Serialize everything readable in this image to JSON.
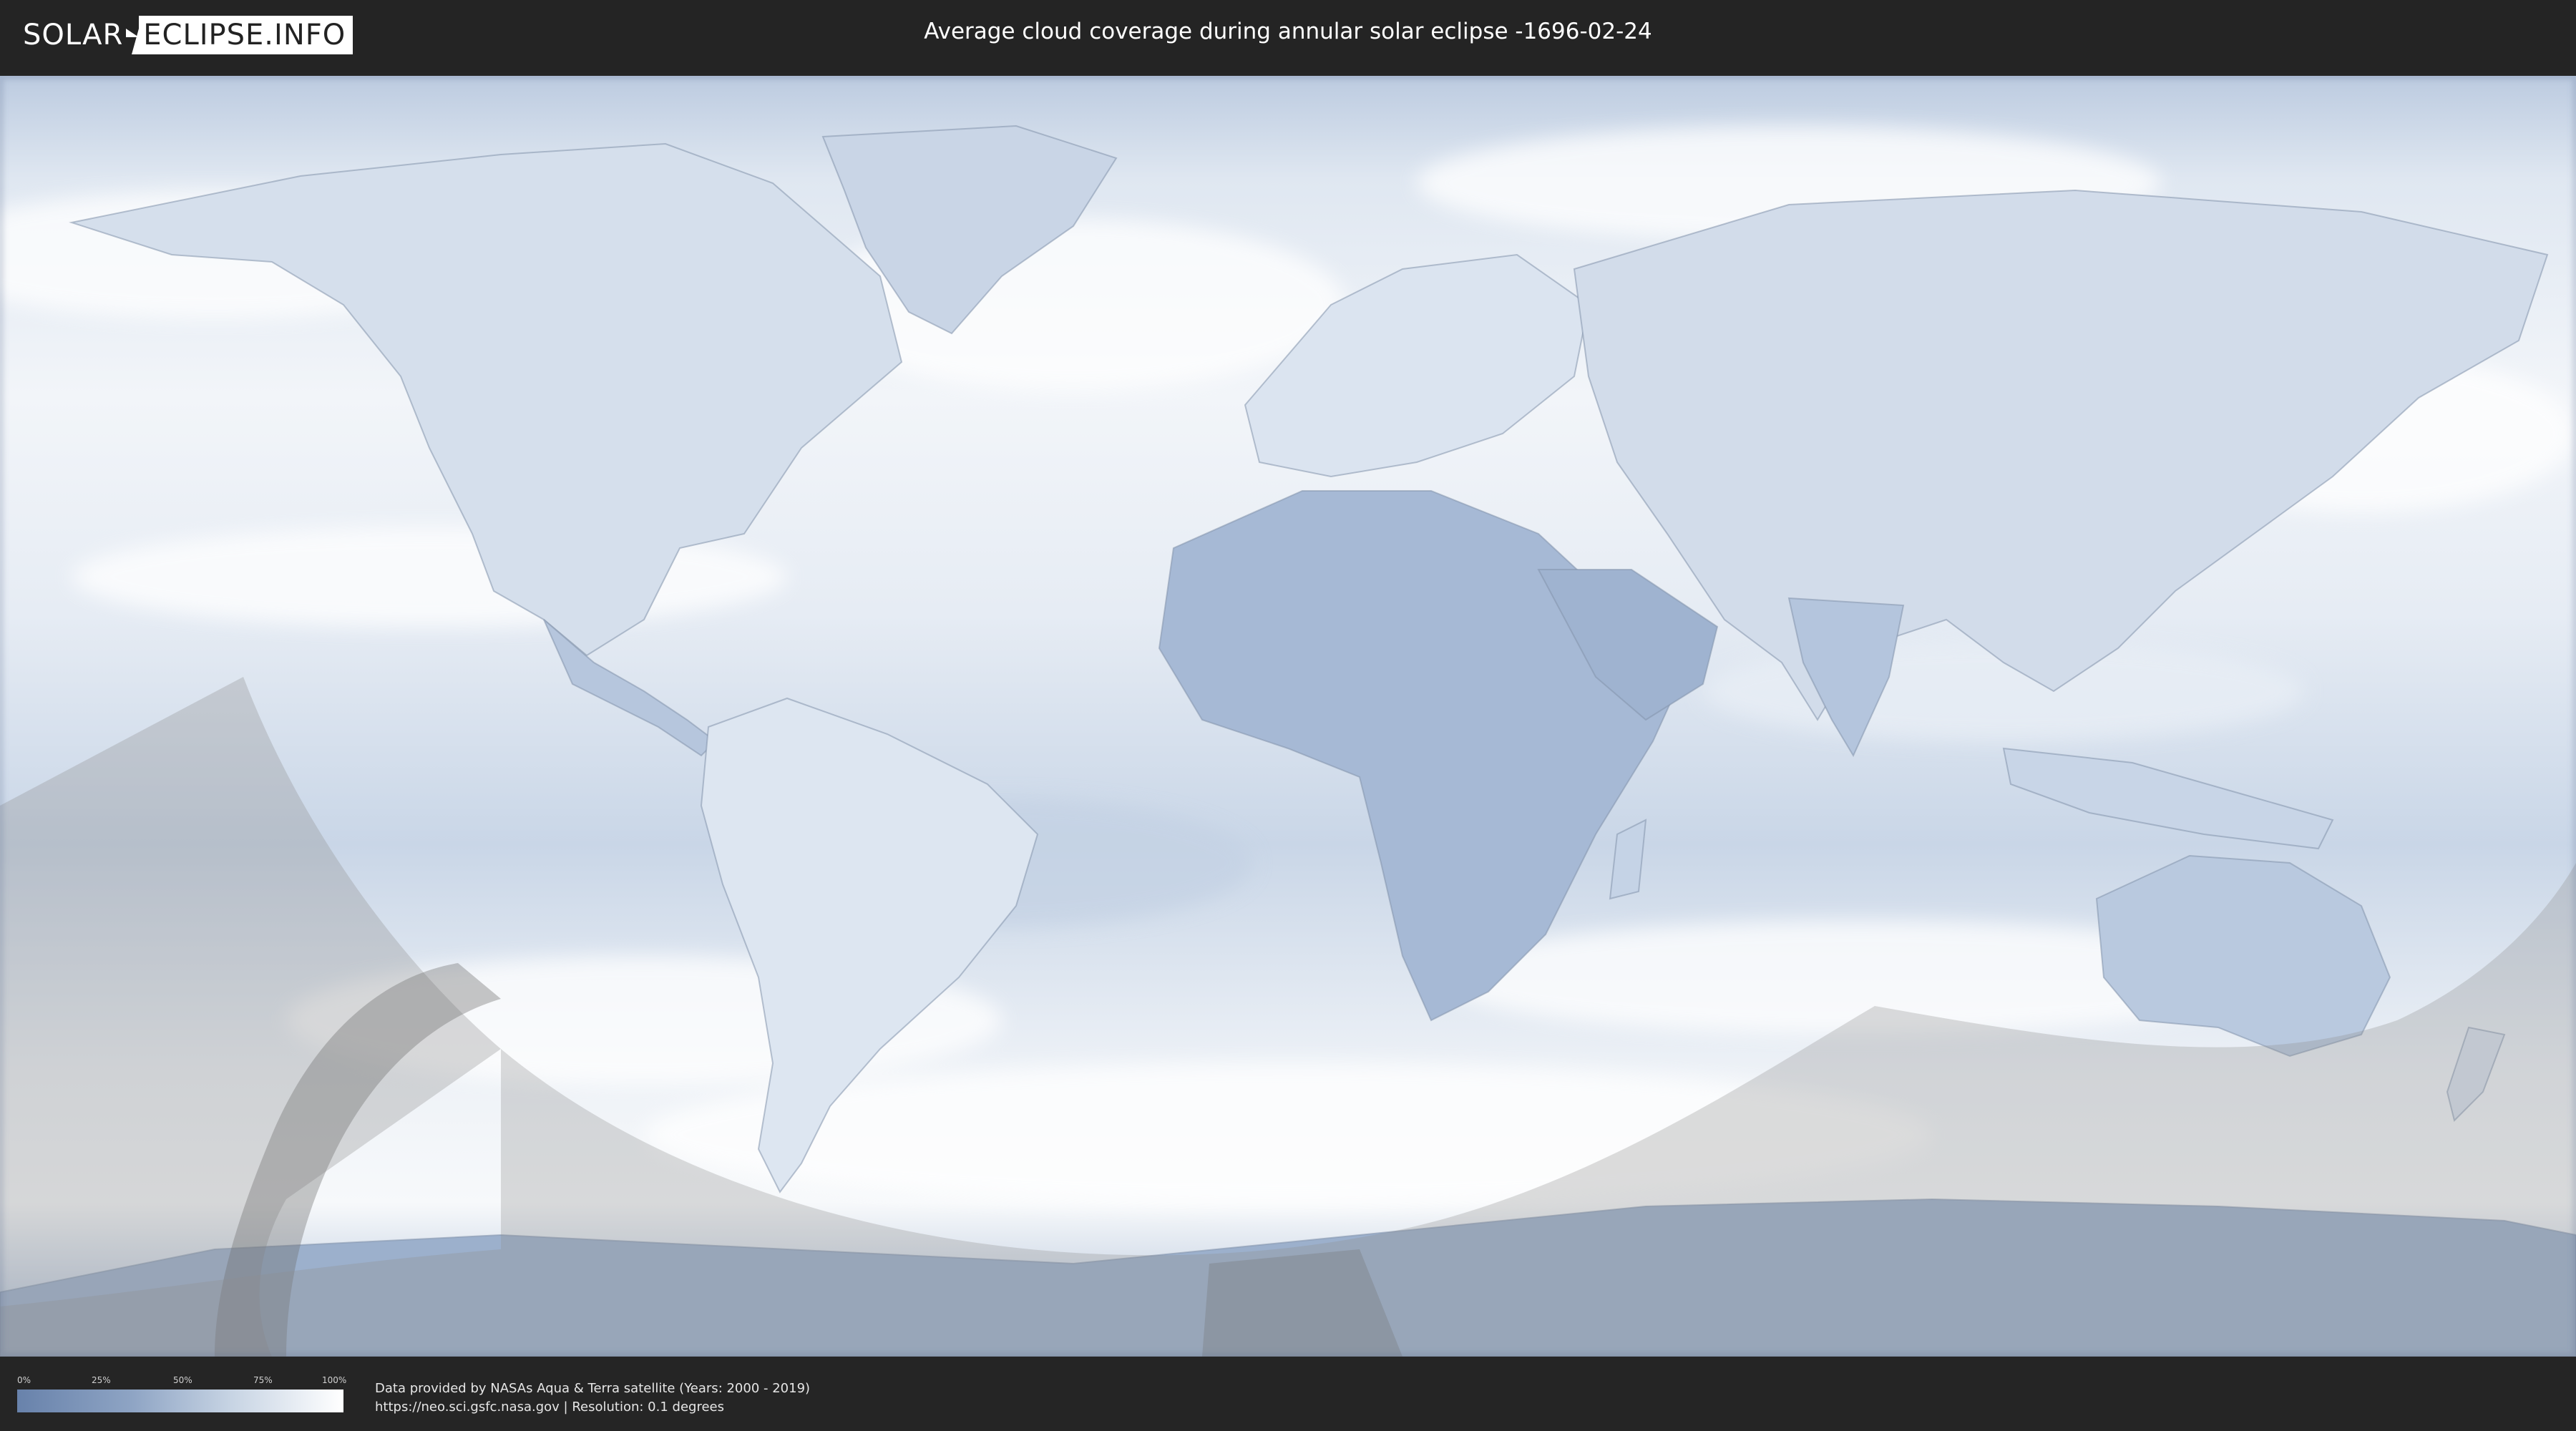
{
  "header": {
    "logo_left": "SOLAR",
    "logo_right": "ECLIPSE.INFO",
    "title": "Average cloud coverage during annular solar eclipse -1696-02-24"
  },
  "map": {
    "layer": "cloud-coverage",
    "colors": {
      "clear": "#6882ab",
      "overcast": "#ffffff",
      "shadow_zone": "#8a8a8a"
    }
  },
  "legend": {
    "ticks": [
      "0%",
      "25%",
      "50%",
      "75%",
      "100%"
    ],
    "colors": [
      "#6882ab",
      "#ffffff"
    ]
  },
  "footer": {
    "attribution_line1": "Data provided by NASAs Aqua & Terra satellite (Years: 2000 - 2019)",
    "attribution_line2": "https://neo.sci.gsfc.nasa.gov | Resolution: 0.1 degrees"
  }
}
